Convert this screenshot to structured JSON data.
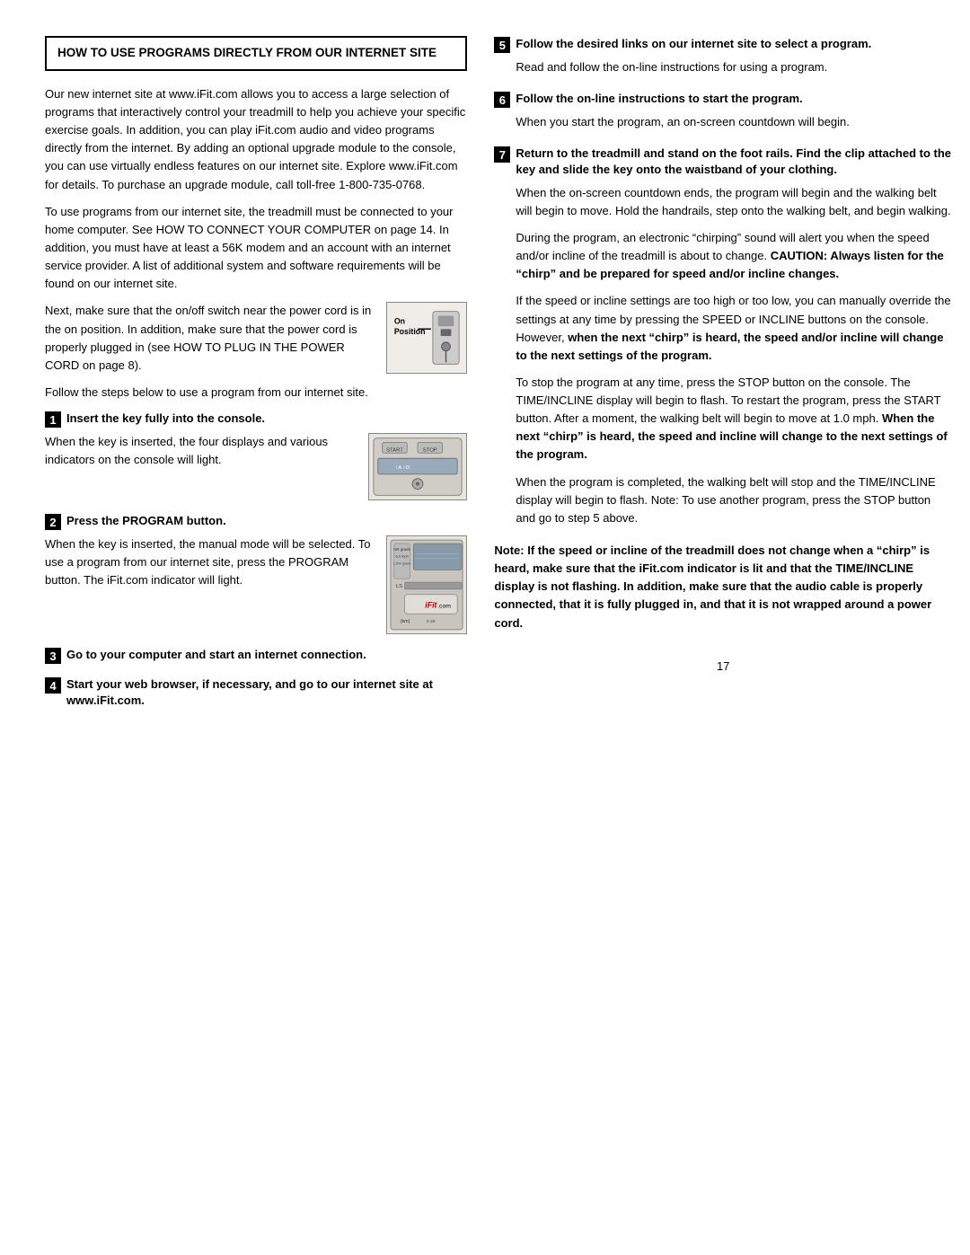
{
  "header": {
    "title": "HOW TO USE PROGRAMS DIRECTLY FROM OUR INTERNET SITE"
  },
  "left": {
    "intro_para1": "Our new internet site at www.iFit.com allows you to access a large selection of programs that interactively control your treadmill to help you achieve your specific exercise goals. In addition, you can play iFit.com audio and video programs directly from the internet. By adding an optional upgrade module to the console, you can use virtually endless features on our internet site. Explore www.iFit.com for details. To purchase an upgrade module, call toll-free 1-800-735-0768.",
    "intro_para2": "To use programs from our internet site, the treadmill must be connected to your home computer. See HOW TO CONNECT YOUR COMPUTER on page 14. In addition, you must have at least a 56K modem and an account with an internet service provider. A list of additional system and software requirements will be found on our internet site.",
    "switch_para": "Next, make sure that the on/off switch near the power cord is in the on position. In addition, make sure that the power cord is properly plugged in (see HOW TO PLUG IN THE POWER CORD on page 8).",
    "switch_label": "On\nPosition",
    "follow_para": "Follow the steps below to use a program from our internet site.",
    "step1_title": "Insert the key fully into the console.",
    "step1_text": "When the key is inserted, the four displays and various indicators on the console will light.",
    "step2_title": "Press the PROGRAM button.",
    "step2_text": "When the key is inserted, the manual mode will be selected. To use a program from our internet site, press the PROGRAM button. The iFit.com indicator will light.",
    "step3_title": "Go to your computer and start an internet connection.",
    "step4_title": "Start your web browser, if necessary, and go to our internet site at www.iFit.com."
  },
  "right": {
    "step5_title": "Follow the desired links on our internet site to select a program.",
    "step5_text": "Read and follow the on-line instructions for using a program.",
    "step6_title": "Follow the on-line instructions to start the program.",
    "step6_text": "When you start the program, an on-screen countdown will begin.",
    "step7_title": "Return to the treadmill and stand on the foot rails. Find the clip attached to the key and slide the key onto the waistband of your clothing.",
    "step7_text1": "When the on-screen countdown ends, the program will begin and the walking belt will begin to move. Hold the handrails, step onto the walking belt, and begin walking.",
    "step7_text2": "During the program, an electronic “chirping” sound will alert you when the speed and/or incline of the treadmill is about to change.",
    "step7_caution": "CAUTION: Always listen for the “chirp” and be prepared for speed and/or incline changes.",
    "step7_text3": "If the speed or incline settings are too high or too low, you can manually override the settings at any time by pressing the SPEED or INCLINE buttons on the console. However,",
    "step7_bold3": "when the next “chirp” is heard, the speed and/or incline will change to the next settings of the program.",
    "step7_text4": "To stop the program at any time, press the STOP button on the console. The TIME/INCLINE display will begin to flash. To restart the program, press the START button. After a moment, the walking belt will begin to move at 1.0 mph.",
    "step7_bold4": "When the next “chirp” is heard, the speed and incline will change to the next settings of the program.",
    "step7_text5": "When the program is completed, the walking belt will stop and the TIME/INCLINE display will begin to flash. Note: To use another program, press the STOP button and go to step 5 above.",
    "note_bold": "Note: If the speed or incline of the treadmill does not change when a “chirp” is heard, make sure that the iFit.com indicator is lit and that the TIME/INCLINE display is not flashing. In addition, make sure that the audio cable is properly connected, that it is fully plugged in, and that it is not wrapped around a power cord.",
    "page_number": "17"
  }
}
